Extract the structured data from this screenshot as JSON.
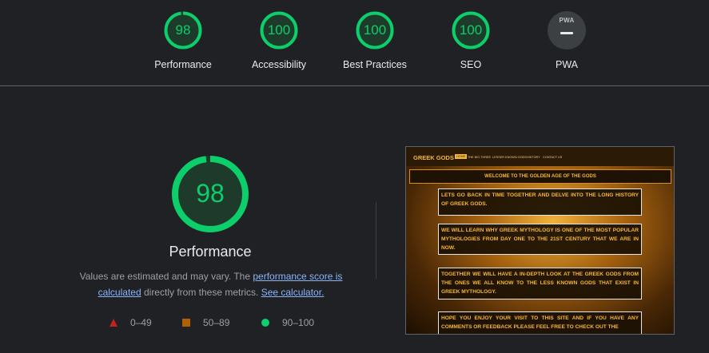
{
  "categories": [
    {
      "score": "98",
      "label": "Performance",
      "fraction": 0.98
    },
    {
      "score": "100",
      "label": "Accessibility",
      "fraction": 1.0
    },
    {
      "score": "100",
      "label": "Best Practices",
      "fraction": 1.0
    },
    {
      "score": "100",
      "label": "SEO",
      "fraction": 1.0
    }
  ],
  "pwa": {
    "badge_text": "PWA",
    "label": "PWA"
  },
  "main": {
    "score": "98",
    "fraction": 0.98,
    "title": "Performance",
    "desc_prefix": "Values are estimated and may vary. The ",
    "link_score": "performance score is calculated",
    "desc_mid": " directly from these metrics. ",
    "link_calc": "See calculator."
  },
  "legend": [
    {
      "range": "0–49",
      "color": "#c5221f"
    },
    {
      "range": "50–89",
      "color": "#b06000"
    },
    {
      "range": "90–100",
      "color": "#0cce6b"
    }
  ],
  "colors": {
    "pass": "#0cce6b",
    "gauge_fill": "#1e3a2b",
    "track": "#3c4043"
  },
  "screenshot": {
    "brand": "GREEK GODS",
    "nav": [
      "HOME",
      "THE BIG THREE",
      "LESSER KNOWN GODS",
      "HISTORY",
      "CONTACT US"
    ],
    "welcome": "WELCOME TO THE GOLDEN AGE OF THE GODS",
    "paragraphs": [
      "LETS GO BACK IN TIME TOGETHER AND DELVE INTO THE LONG HISTORY OF GREEK GODS.",
      "WE WILL LEARN WHY GREEK MYTHOLOGY IS ONE OF THE MOST POPULAR MYTHOLOGIES FROM DAY ONE TO THE 21ST CENTURY THAT WE ARE IN NOW.",
      "TOGETHER WE WILL HAVE A IN-DEPTH LOOK AT THE GREEK GODS FROM THE ONES WE ALL KNOW TO THE LESS KNOWN GODS THAT EXIST IN GREEK MYTHOLOGY.",
      "HOPE YOU ENJOY YOUR VISIT TO THIS SITE AND IF YOU HAVE ANY COMMENTS OR FEEDBACK PLEASE FEEL FREE TO CHECK OUT THE"
    ]
  }
}
